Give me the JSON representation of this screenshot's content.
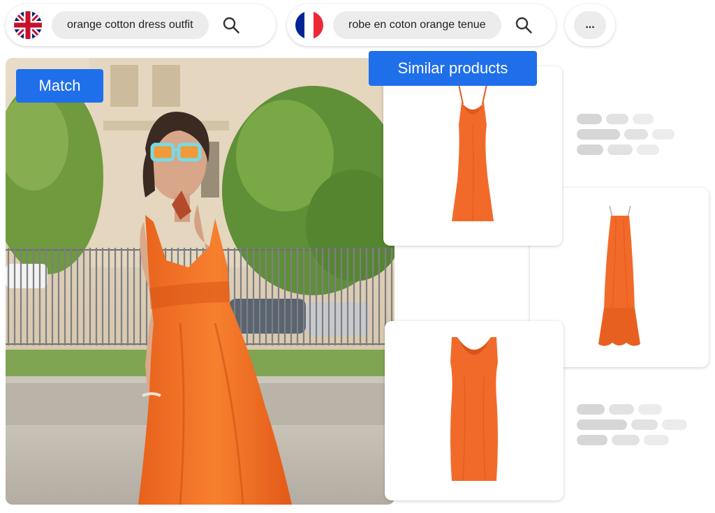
{
  "search_bar_en": {
    "flag": "uk-flag-icon",
    "query": "orange cotton dress outfit",
    "search_icon": "search-icon"
  },
  "search_bar_fr": {
    "flag": "france-flag-icon",
    "query": "robe en coton orange tenue",
    "search_icon": "search-icon"
  },
  "more_button": {
    "label": "..."
  },
  "labels": {
    "match": "Match",
    "similar_products": "Similar products"
  },
  "colors": {
    "accent": "#1f6feb",
    "dress_orange": "#f26a2a",
    "skeleton": "#d6d6d6"
  },
  "products": [
    {
      "name": "product-card-slip-dress"
    },
    {
      "name": "product-card-tiered-maxi-dress"
    },
    {
      "name": "product-card-bodycon-dress"
    }
  ]
}
